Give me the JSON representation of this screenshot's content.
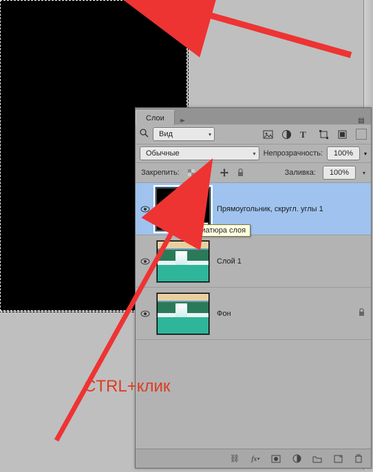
{
  "panel": {
    "tab_label": "Слои",
    "filter_label": "Вид",
    "blend_mode": "Обычные",
    "opacity_label": "Непрозрачность:",
    "opacity_value": "100%",
    "fill_label": "Заливка:",
    "fill_value": "100%",
    "lock_label": "Закрепить:"
  },
  "layers": [
    {
      "name": "Прямоугольник, скругл. углы 1",
      "visible": true,
      "selected": true,
      "thumb": "black"
    },
    {
      "name": "Слой 1",
      "visible": true,
      "selected": false,
      "thumb": "waterfall"
    },
    {
      "name": "Фон",
      "visible": true,
      "selected": false,
      "thumb": "waterfall",
      "locked": true
    }
  ],
  "tooltip": "Миниатюра слоя",
  "annotation": "CTRL+клик",
  "icons": {
    "search": "search-icon",
    "image": "image-icon",
    "adjust": "adjust-icon",
    "type": "type-icon",
    "crop": "crop-icon",
    "smart": "smart-icon",
    "pixels": "pixels-lock-icon",
    "brush": "brush-icon",
    "move": "move-icon",
    "lock": "lock-icon",
    "eye": "eye-icon",
    "link": "link-icon",
    "fx": "fx-icon",
    "mask": "mask-icon",
    "fillnew": "fill-adjust-icon",
    "group": "group-icon",
    "newlayer": "new-layer-icon",
    "trash": "trash-icon",
    "menu": "menu-icon"
  }
}
